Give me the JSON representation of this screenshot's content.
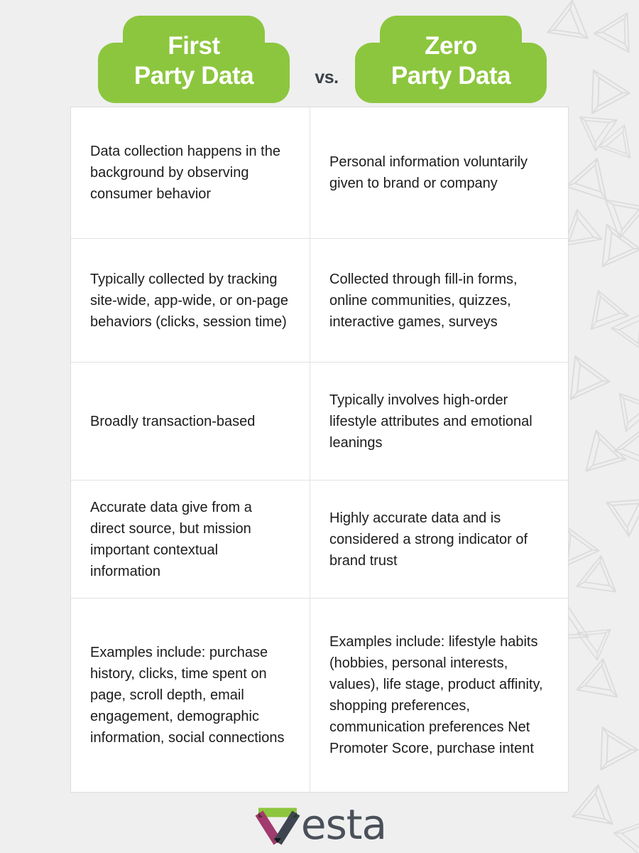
{
  "colors": {
    "green": "#8cc63e",
    "background": "#efefef",
    "card": "#ffffff",
    "border": "#e2e2e2",
    "text": "#1c1c1c",
    "vs_text": "#3a4049",
    "logo_word": "#4a5059",
    "logo_green": "#8cc63e",
    "logo_magenta": "#a13a6e",
    "logo_dark": "#3f4550",
    "decor_triangle": "#dddddd"
  },
  "header": {
    "left_badge": {
      "line1": "First",
      "line2": "Party Data"
    },
    "versus": "vs.",
    "right_badge": {
      "line1": "Zero",
      "line2": "Party Data"
    }
  },
  "comparison": {
    "rows": [
      {
        "first_party": "Data collection happens in the background by observing consumer behavior",
        "zero_party": "Personal information voluntarily given to brand or company"
      },
      {
        "first_party": "Typically collected by tracking site-wide, app-wide, or on-page behaviors (clicks, session time)",
        "zero_party": "Collected through fill-in forms, online communities, quizzes, interactive games, surveys"
      },
      {
        "first_party": "Broadly transaction-based",
        "zero_party": "Typically involves high-order lifestyle attributes and emotional leanings"
      },
      {
        "first_party": "Accurate data give from a direct source, but mission important contextual information",
        "zero_party": "Highly accurate data and is considered a strong indicator of brand trust"
      },
      {
        "first_party": "Examples include: purchase history, clicks, time spent on page, scroll depth, email engagement, demographic information, social connections",
        "zero_party": "Examples include: lifestyle habits (hobbies, personal interests, values), life stage, product affinity, shopping preferences, communication preferences Net Promoter Score, purchase intent"
      }
    ]
  },
  "footer": {
    "logo_text": "esta",
    "logo_mark": "vesta-triangle-logomark"
  }
}
